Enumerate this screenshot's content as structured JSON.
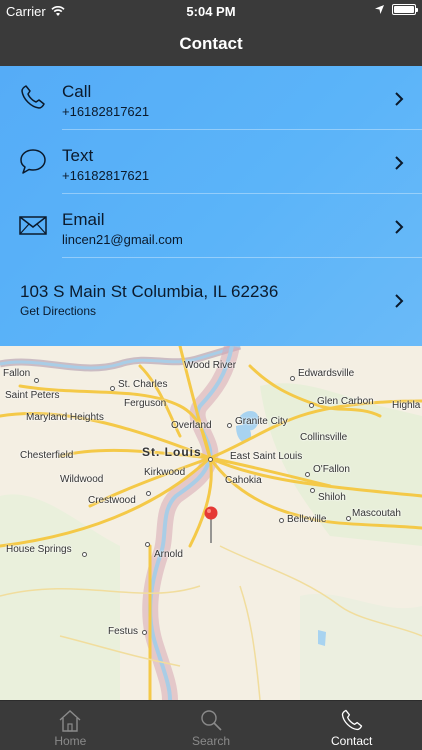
{
  "status_bar": {
    "carrier": "Carrier",
    "time": "5:04 PM"
  },
  "nav": {
    "title": "Contact"
  },
  "contacts": {
    "call": {
      "title": "Call",
      "subtitle": "+16182817621",
      "icon": "phone-icon"
    },
    "text": {
      "title": "Text",
      "subtitle": "+16182817621",
      "icon": "speech-bubble-icon"
    },
    "email": {
      "title": "Email",
      "subtitle": "lincen21@gmail.com",
      "icon": "envelope-icon"
    },
    "address": {
      "title": "103 S Main St Columbia, IL 62236",
      "subtitle": "Get Directions"
    }
  },
  "map": {
    "labels": {
      "fallon": "Fallon",
      "wood_river": "Wood River",
      "edwardsville": "Edwardsville",
      "st_charles": "St. Charles",
      "saint_peters": "Saint Peters",
      "ferguson": "Ferguson",
      "glen_carbon": "Glen Carbon",
      "highland": "Highla",
      "maryland_heights": "Maryland Heights",
      "overland": "Overland",
      "granite_city": "Granite City",
      "chesterfield": "Chesterfield",
      "st_louis": "St. Louis",
      "collinsville": "Collinsville",
      "east_saint_louis": "East Saint Louis",
      "ofallon": "O'Fallon",
      "wildwood": "Wildwood",
      "kirkwood": "Kirkwood",
      "cahokia": "Cahokia",
      "shiloh": "Shiloh",
      "crestwood": "Crestwood",
      "belleville": "Belleville",
      "mascoutah": "Mascoutah",
      "house_springs": "House Springs",
      "arnold": "Arnold",
      "festus": "Festus"
    }
  },
  "tabs": [
    {
      "label": "Home",
      "icon": "house-icon",
      "active": false
    },
    {
      "label": "Search",
      "icon": "magnifier-icon",
      "active": false
    },
    {
      "label": "Contact",
      "icon": "phone-icon",
      "active": true
    }
  ],
  "colors": {
    "bar": "#3a3a3a",
    "list": "#5bb4f9",
    "accent_text": "#0b1a2c",
    "pin": "#e53935"
  }
}
